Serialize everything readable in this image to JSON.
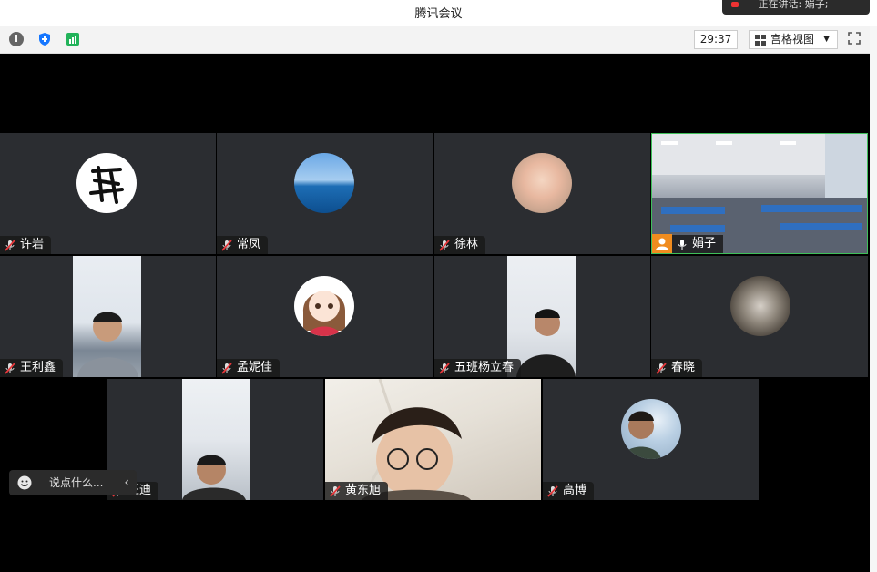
{
  "window": {
    "title": "腾讯会议",
    "speaking_text": "正在讲话: 娟子;"
  },
  "toolbar": {
    "info_icon": "info-icon",
    "shield_icon": "shield-icon",
    "signal_icon": "signal-icon",
    "timer": "29:37",
    "view_label": "宫格视图",
    "view_caret": "▼",
    "fullscreen_icon": "fullscreen-icon"
  },
  "participants": [
    {
      "name": "许岩",
      "mic": "muted"
    },
    {
      "name": "常凤",
      "mic": "muted"
    },
    {
      "name": "徐林",
      "mic": "muted"
    },
    {
      "name": "娟子",
      "mic": "active"
    },
    {
      "name": "王利鑫",
      "mic": "muted"
    },
    {
      "name": "孟妮佳",
      "mic": "muted"
    },
    {
      "name": "五班杨立春",
      "mic": "muted"
    },
    {
      "name": "春晓",
      "mic": "muted"
    },
    {
      "name": "王迪",
      "mic": "muted"
    },
    {
      "name": "黄东旭",
      "mic": "muted"
    },
    {
      "name": "高博",
      "mic": "muted"
    }
  ],
  "chat": {
    "placeholder": "说点什么...",
    "collapse_arrow": "‹"
  },
  "colors": {
    "tile_bg": "#2b2d31",
    "active_border": "#3fbf5a",
    "muted_mic": "#e5383b",
    "accent_blue": "#1677ff"
  }
}
